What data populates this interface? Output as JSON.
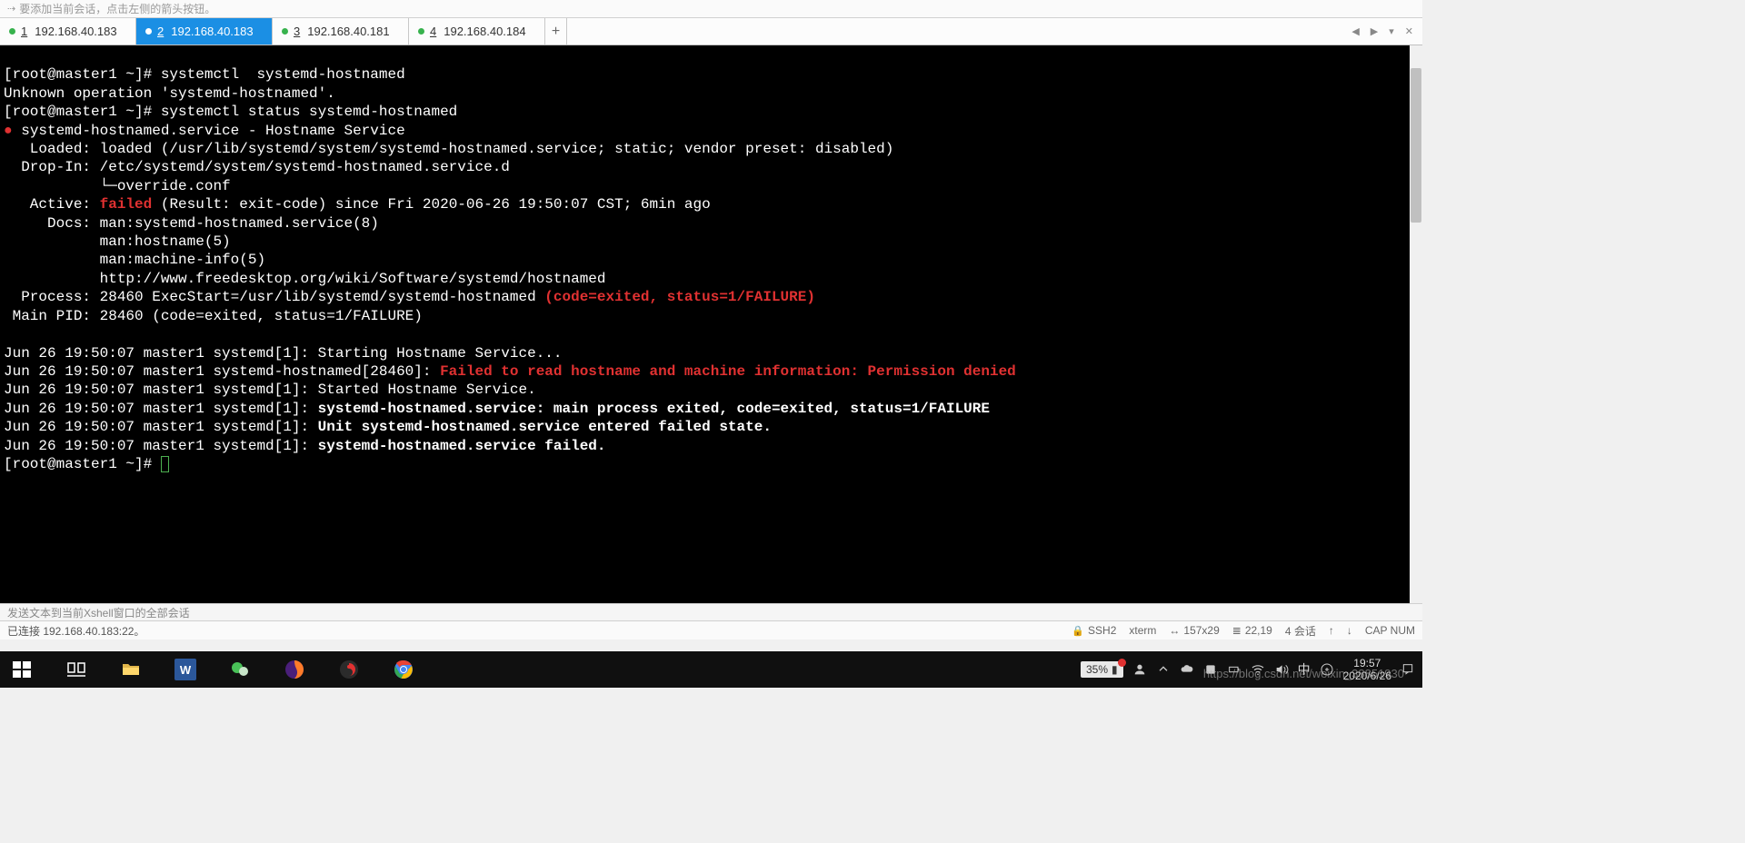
{
  "hint": "要添加当前会话，点击左侧的箭头按钮。",
  "tabs": [
    {
      "index": "1",
      "label": "192.168.40.183",
      "active": false
    },
    {
      "index": "2",
      "label": "192.168.40.183",
      "active": true
    },
    {
      "index": "3",
      "label": "192.168.40.181",
      "active": false
    },
    {
      "index": "4",
      "label": "192.168.40.184",
      "active": false
    }
  ],
  "terminal": {
    "prompt": "[root@master1 ~]# ",
    "cmd1": "systemctl  systemd-hostnamed",
    "err1": "Unknown operation 'systemd-hostnamed'.",
    "cmd2": "systemctl status systemd-hostnamed",
    "svc_line": " systemd-hostnamed.service - Hostname Service",
    "loaded": "   Loaded: loaded (/usr/lib/systemd/system/systemd-hostnamed.service; static; vendor preset: disabled)",
    "dropin1": "  Drop-In: /etc/systemd/system/systemd-hostnamed.service.d",
    "dropin2": "           └─override.conf",
    "active_lbl": "   Active: ",
    "active_val": "failed",
    "active_rest": " (Result: exit-code) since Fri 2020-06-26 19:50:07 CST; 6min ago",
    "docs1": "     Docs: man:systemd-hostnamed.service(8)",
    "docs2": "           man:hostname(5)",
    "docs3": "           man:machine-info(5)",
    "docs4": "           http://www.freedesktop.org/wiki/Software/systemd/hostnamed",
    "proc_lbl": "  Process: 28460 ExecStart=/usr/lib/systemd/systemd-hostnamed ",
    "proc_red": "(code=exited, status=1/FAILURE)",
    "mainpid": " Main PID: 28460 (code=exited, status=1/FAILURE)",
    "log1_pre": "Jun 26 19:50:07 master1 systemd[1]: Starting Hostname Service...",
    "log2_pre": "Jun 26 19:50:07 master1 systemd-hostnamed[28460]: ",
    "log2_red": "Failed to read hostname and machine information: Permission denied",
    "log3": "Jun 26 19:50:07 master1 systemd[1]: Started Hostname Service.",
    "log4_pre": "Jun 26 19:50:07 master1 systemd[1]: ",
    "log4_b": "systemd-hostnamed.service: main process exited, code=exited, status=1/FAILURE",
    "log5_pre": "Jun 26 19:50:07 master1 systemd[1]: ",
    "log5_b": "Unit systemd-hostnamed.service entered failed state.",
    "log6_pre": "Jun 26 19:50:07 master1 systemd[1]: ",
    "log6_b": "systemd-hostnamed.service failed."
  },
  "compose_hint": "发送文本到当前Xshell窗口的全部会话",
  "status": {
    "left": "已连接 192.168.40.183:22。",
    "proto": "SSH2",
    "term": "xterm",
    "size": "157x29",
    "pos": "22,19",
    "sessions": "4 会话",
    "cap": "CAP NUM"
  },
  "battery": "35%",
  "ime": "中",
  "clock": {
    "time": "19:57",
    "date": "2020/6/26"
  },
  "watermark": "https://blog.csdn.net/weixin_38851930"
}
